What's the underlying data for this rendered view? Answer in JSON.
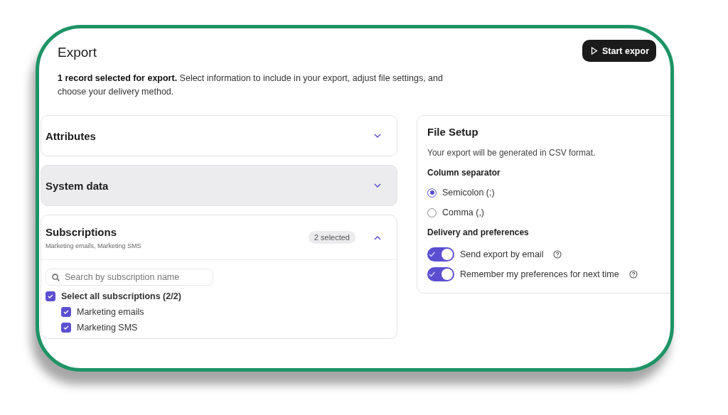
{
  "header": {
    "title": "Export",
    "description": "**1 record selected for export.** Select information to include in your export, adjust file settings, and choose your delivery method.",
    "start_button": "Start expor"
  },
  "sections": [
    {
      "title": "Attributes",
      "expanded": false,
      "shaded": false
    },
    {
      "title": "System data",
      "expanded": false,
      "shaded": true
    },
    {
      "title": "Subscriptions",
      "expanded": true,
      "shaded": false,
      "subtitle": "Marketing emails, Marketing SMS",
      "badge": "2 selected",
      "search": {
        "placeholder": "Search by subscription name"
      },
      "select_all": {
        "label": "Select all subscriptions (2/2)",
        "checked": true
      },
      "items": [
        {
          "label": "Marketing emails",
          "checked": true
        },
        {
          "label": "Marketing SMS",
          "checked": true
        }
      ]
    }
  ],
  "file_setup": {
    "title": "File Setup",
    "note": "Your export will be generated in CSV format.",
    "separator_label": "Column separator",
    "separators": [
      {
        "label": "Semicolon (;)",
        "selected": true
      },
      {
        "label": "Comma (,)",
        "selected": false
      }
    ],
    "delivery_label": "Delivery and preferences",
    "toggles": [
      {
        "label": "Send export by email",
        "on": true
      },
      {
        "label": "Remember my preferences for next time",
        "on": true
      }
    ]
  }
}
